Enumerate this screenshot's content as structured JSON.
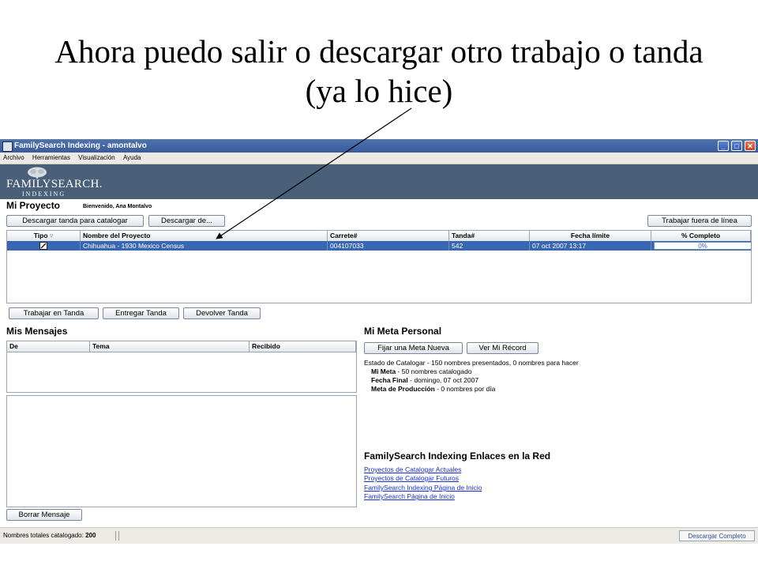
{
  "slide": {
    "title_line1": "Ahora puedo salir o descargar otro trabajo o tanda",
    "title_line2": "(ya lo hice)"
  },
  "window": {
    "title": "FamilySearch Indexing - amontalvo",
    "minimize": "_",
    "maximize": "□",
    "close": "✕"
  },
  "menu": [
    "Archivo",
    "Herramientas",
    "Visualización",
    "Ayuda"
  ],
  "brand": {
    "name": "FAMILYSEARCH.",
    "sub": "INDEXING"
  },
  "project": {
    "title": "Mi Proyecto",
    "welcome": "Bienvenido, Ana Montalvo",
    "buttons": {
      "download_batch": "Descargar tanda para catalogar",
      "download_from": "Descargar de...",
      "work_offline": "Trabajar fuera de línea"
    },
    "columns": [
      "Tipo",
      "Nombre del Proyecto",
      "Carrete#",
      "Tanda#",
      "Fecha límite",
      "% Completo"
    ],
    "sort_indicator": "▿",
    "rows": [
      {
        "name": "Chihuahua - 1930 Mexico Census",
        "reel": "004107033",
        "batch": "542",
        "due": "07 oct 2007 13:17",
        "percent": 0,
        "percent_label": "0%"
      }
    ],
    "actions": {
      "work": "Trabajar en Tanda",
      "submit": "Entregar Tanda",
      "return": "Devolver Tanda"
    }
  },
  "messages": {
    "title": "Mis Mensajes",
    "columns": [
      "De",
      "Tema",
      "Recibido"
    ],
    "delete": "Borrar Mensaje"
  },
  "goal": {
    "title": "Mi Meta Personal",
    "set_goal": "Fijar una Meta Nueva",
    "view_record": "Ver Mi Récord",
    "status": "Estado de Catalogar - 150 nombres presentados, 0 nombres para hacer",
    "my_goal_label": "Mi Meta",
    "my_goal_value": " - 50 nombres catalogado",
    "end_date_label": "Fecha Final",
    "end_date_value": " - domingo, 07 oct 2007",
    "production_label": "Meta de Producción",
    "production_value": " - 0 nombres por día"
  },
  "links": {
    "title": "FamilySearch Indexing Enlaces en la Red",
    "items": [
      "Proyectos de Catalogar Actuales",
      "Proyectos de Catalogar Futuros",
      "FamilySearch Indexing Página de Inicio",
      "FamilySearch Página de Inicio"
    ]
  },
  "status": {
    "total_label": "Nombres totales catalogado:",
    "total_value": "200",
    "download_complete": "Descargar Completo"
  },
  "colors": {
    "banner": "#4a5f78",
    "selection": "#3767b2",
    "link": "#1a2fd1"
  }
}
